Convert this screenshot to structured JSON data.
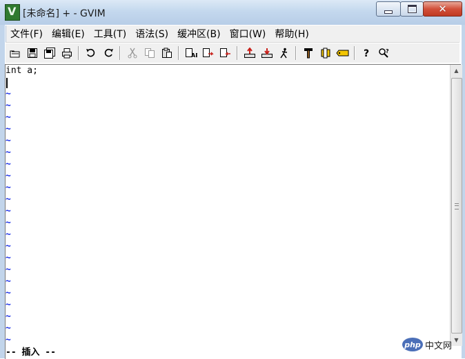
{
  "window": {
    "title": "[未命名] + - GVIM",
    "controls": {
      "close": "✕"
    }
  },
  "menu": [
    {
      "label": "文件(F)"
    },
    {
      "label": "编辑(E)"
    },
    {
      "label": "工具(T)"
    },
    {
      "label": "语法(S)"
    },
    {
      "label": "缓冲区(B)"
    },
    {
      "label": "窗口(W)"
    },
    {
      "label": "帮助(H)"
    }
  ],
  "toolbar": {
    "icons": [
      "open-icon",
      "save-icon",
      "save-all-icon",
      "print-icon",
      "undo-icon",
      "redo-icon",
      "cut-icon",
      "copy-icon",
      "paste-icon",
      "find-replace-icon",
      "find-next-icon",
      "find-prev-icon",
      "load-session-icon",
      "save-session-icon",
      "run-script-icon",
      "make-icon",
      "run-ctags-icon",
      "jump-tag-icon",
      "help-icon",
      "find-help-icon"
    ]
  },
  "editor": {
    "lines": [
      "int a;",
      ""
    ],
    "tilde": "~",
    "mode": "-- 插入 --",
    "tilde_color": "#1a2fe6"
  },
  "watermark": {
    "badge": "php",
    "text": "中文网"
  }
}
